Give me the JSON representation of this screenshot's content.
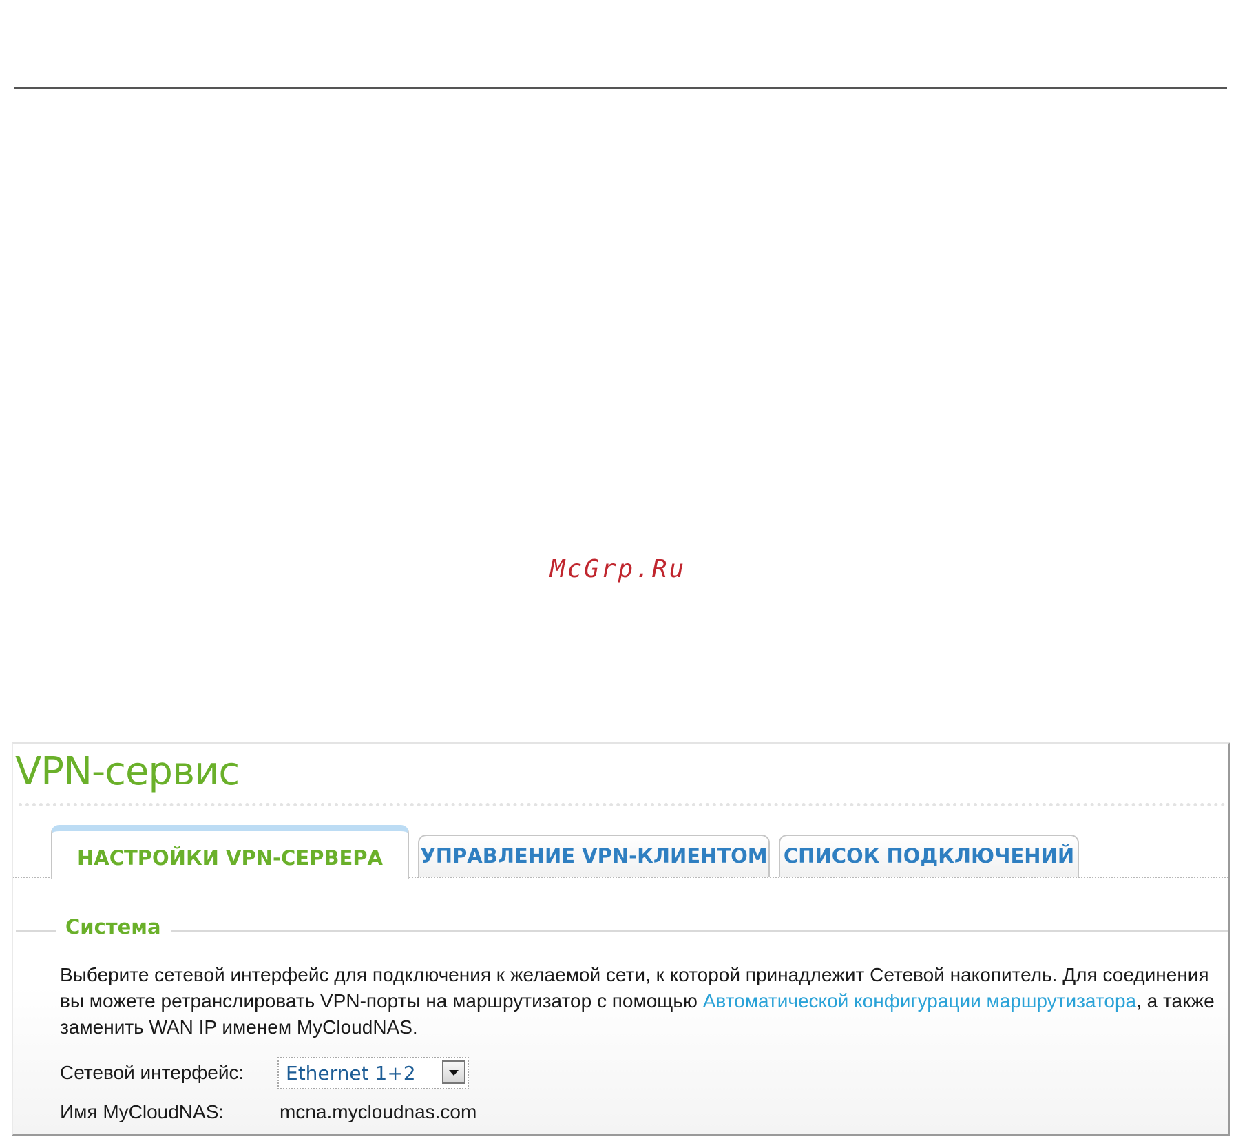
{
  "watermark": "McGrp.Ru",
  "page": {
    "title": "VPN-сервис"
  },
  "tabs": [
    {
      "label": "НАСТРОЙКИ VPN-СЕРВЕРА",
      "active": true
    },
    {
      "label": "УПРАВЛЕНИЕ VPN-КЛИЕНТОМ",
      "active": false
    },
    {
      "label": "СПИСОК ПОДКЛЮЧЕНИЙ",
      "active": false
    }
  ],
  "system": {
    "legend": "Система",
    "description_part1": "Выберите сетевой интерфейс для подключения к желаемой сети, к которой принадлежит Сетевой накопитель. Для соединения вы можете ретранслировать VPN-порты на маршрутизатор с помощью ",
    "link_text": "Автоматической конфигурации маршрутизатора",
    "description_part2": ", а также заменить WAN IP именем MyCloudNAS.",
    "interface_label": "Сетевой интерфейс:",
    "interface_value": "Ethernet 1+2",
    "name_label": "Имя MyCloudNAS:",
    "name_value": "mcna.mycloudnas.com"
  },
  "icons": {
    "dropdown": "chevron-down-icon"
  },
  "colors": {
    "title_green": "#6ab02a",
    "tab_blue": "#2f7fc1",
    "link_blue": "#2aa2d7",
    "watermark_red": "#c0262e"
  }
}
